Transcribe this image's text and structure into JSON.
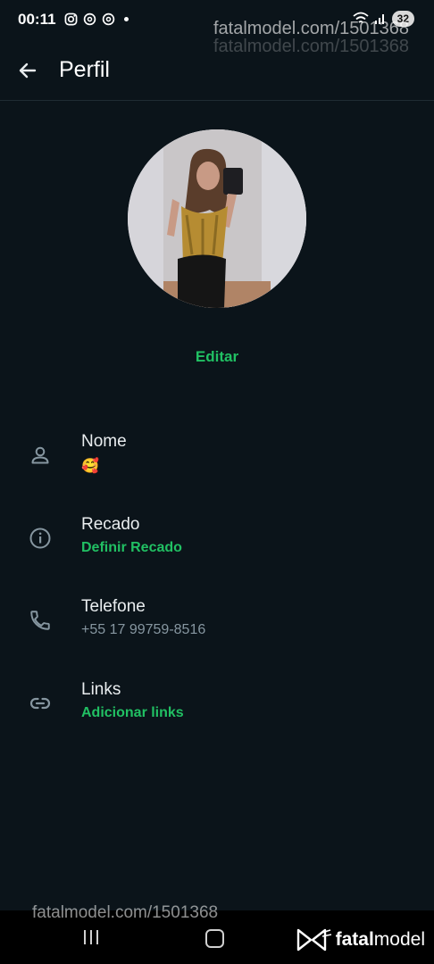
{
  "status_bar": {
    "time": "00:11",
    "battery": "32",
    "icons_left": [
      "instagram-icon",
      "threads-icon",
      "threads-icon"
    ],
    "icons_right": [
      "wifi-icon",
      "signal-icon",
      "battery-icon"
    ]
  },
  "watermark": {
    "top": "fatalmodel.com/1501368",
    "top_ghost": "fatalmodel.com/1501368",
    "bottom": "fatalmodel.com/1501368"
  },
  "header": {
    "title": "Perfil",
    "back_icon": "arrow-left-icon"
  },
  "profile": {
    "edit_label": "Editar"
  },
  "rows": [
    {
      "icon": "person-icon",
      "label": "Nome",
      "value": "🥰"
    },
    {
      "icon": "info-icon",
      "label": "Recado",
      "value": "Definir Recado"
    },
    {
      "icon": "phone-icon",
      "label": "Telefone",
      "value": "+55 17 99759-8516"
    },
    {
      "icon": "link-icon",
      "label": "Links",
      "value": "Adicionar links"
    }
  ],
  "brand": {
    "prefix": "fatal",
    "suffix": "model"
  },
  "colors": {
    "background": "#0b141a",
    "accent": "#21c063",
    "text_primary": "#e9edef",
    "text_secondary": "#8696a0"
  }
}
